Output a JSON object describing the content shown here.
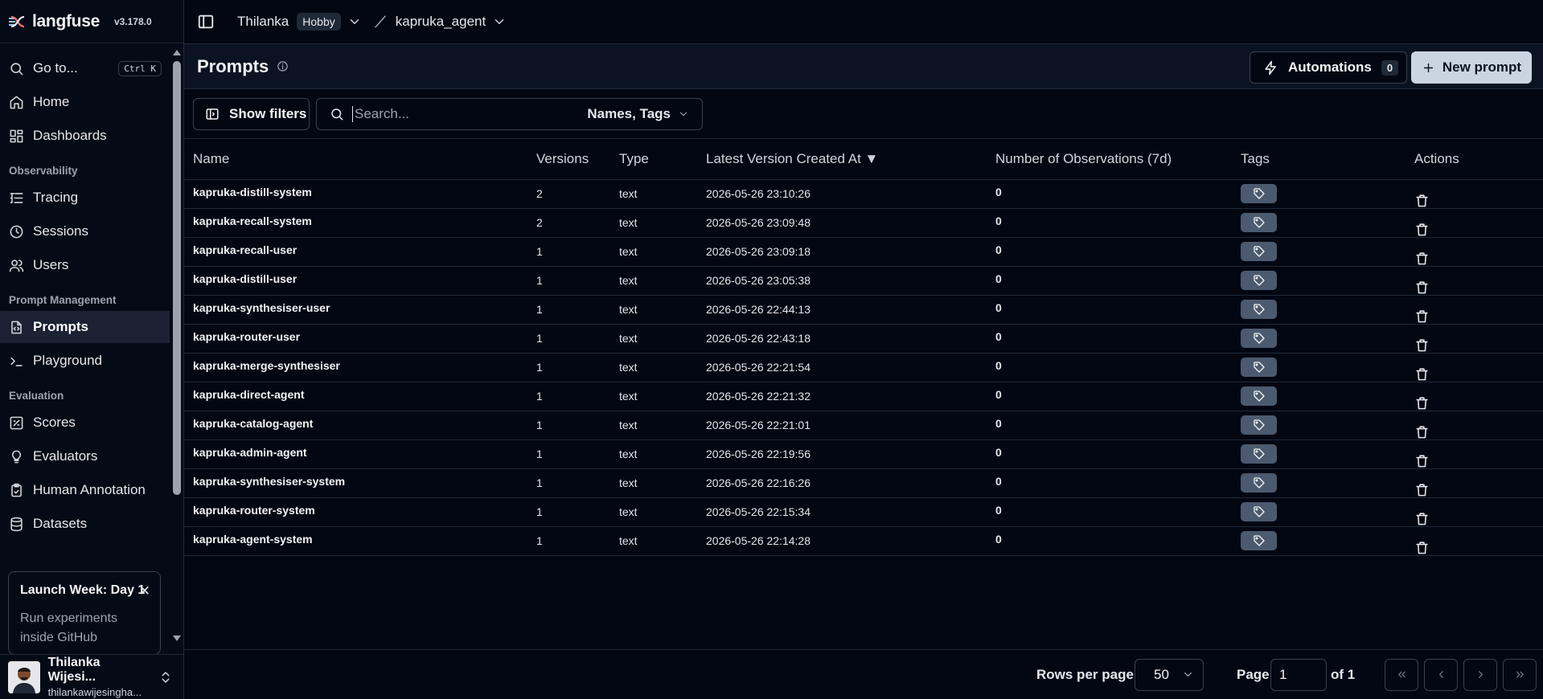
{
  "app": {
    "brand": "langfuse",
    "version": "v3.178.0"
  },
  "sidebar": {
    "goto_label": "Go to...",
    "goto_shortcut": "Ctrl K",
    "items_top": [
      {
        "label": "Home",
        "icon": "home-icon"
      },
      {
        "label": "Dashboards",
        "icon": "dashboard-icon"
      }
    ],
    "sections": [
      {
        "label": "Observability",
        "items": [
          {
            "label": "Tracing",
            "icon": "tracing-icon"
          },
          {
            "label": "Sessions",
            "icon": "clock-icon"
          },
          {
            "label": "Users",
            "icon": "users-icon"
          }
        ]
      },
      {
        "label": "Prompt Management",
        "items": [
          {
            "label": "Prompts",
            "icon": "file-code-icon",
            "active": true
          },
          {
            "label": "Playground",
            "icon": "terminal-icon"
          }
        ]
      },
      {
        "label": "Evaluation",
        "items": [
          {
            "label": "Scores",
            "icon": "scores-icon"
          },
          {
            "label": "Evaluators",
            "icon": "lightbulb-icon"
          },
          {
            "label": "Human Annotation",
            "icon": "clipboard-icon"
          },
          {
            "label": "Datasets",
            "icon": "database-icon"
          }
        ]
      }
    ],
    "launch": {
      "title": "Launch Week: Day 1",
      "body": "Run experiments inside GitHub"
    },
    "user": {
      "name": "Thilanka Wijesi...",
      "email": "thilankawijesingha..."
    }
  },
  "topbar": {
    "org": "Thilanka",
    "plan": "Hobby",
    "project": "kapruka_agent"
  },
  "page": {
    "title": "Prompts",
    "automations_label": "Automations",
    "automations_count": "0",
    "new_prompt_label": "New prompt"
  },
  "filters": {
    "show_filters_label": "Show filters",
    "search_placeholder": "Search...",
    "search_scope": "Names, Tags"
  },
  "table": {
    "columns": [
      "Name",
      "Versions",
      "Type",
      "Latest Version Created At ▼",
      "Number of Observations (7d)",
      "Tags",
      "Actions"
    ],
    "rows": [
      {
        "name": "kapruka-distill-system",
        "versions": "2",
        "type": "text",
        "created": "2026-05-26 23:10:26",
        "obs": "0"
      },
      {
        "name": "kapruka-recall-system",
        "versions": "2",
        "type": "text",
        "created": "2026-05-26 23:09:48",
        "obs": "0"
      },
      {
        "name": "kapruka-recall-user",
        "versions": "1",
        "type": "text",
        "created": "2026-05-26 23:09:18",
        "obs": "0"
      },
      {
        "name": "kapruka-distill-user",
        "versions": "1",
        "type": "text",
        "created": "2026-05-26 23:05:38",
        "obs": "0"
      },
      {
        "name": "kapruka-synthesiser-user",
        "versions": "1",
        "type": "text",
        "created": "2026-05-26 22:44:13",
        "obs": "0"
      },
      {
        "name": "kapruka-router-user",
        "versions": "1",
        "type": "text",
        "created": "2026-05-26 22:43:18",
        "obs": "0"
      },
      {
        "name": "kapruka-merge-synthesiser",
        "versions": "1",
        "type": "text",
        "created": "2026-05-26 22:21:54",
        "obs": "0"
      },
      {
        "name": "kapruka-direct-agent",
        "versions": "1",
        "type": "text",
        "created": "2026-05-26 22:21:32",
        "obs": "0"
      },
      {
        "name": "kapruka-catalog-agent",
        "versions": "1",
        "type": "text",
        "created": "2026-05-26 22:21:01",
        "obs": "0"
      },
      {
        "name": "kapruka-admin-agent",
        "versions": "1",
        "type": "text",
        "created": "2026-05-26 22:19:56",
        "obs": "0"
      },
      {
        "name": "kapruka-synthesiser-system",
        "versions": "1",
        "type": "text",
        "created": "2026-05-26 22:16:26",
        "obs": "0"
      },
      {
        "name": "kapruka-router-system",
        "versions": "1",
        "type": "text",
        "created": "2026-05-26 22:15:34",
        "obs": "0"
      },
      {
        "name": "kapruka-agent-system",
        "versions": "1",
        "type": "text",
        "created": "2026-05-26 22:14:28",
        "obs": "0"
      }
    ]
  },
  "pagination": {
    "rows_per_page_label": "Rows per page",
    "rows_per_page": "50",
    "page_label": "Page",
    "page": "1",
    "of_label": "of 1"
  },
  "colors": {
    "background": "#030712",
    "accent_button": "#cbd5e1",
    "tag_button": "#4b5a6f"
  }
}
